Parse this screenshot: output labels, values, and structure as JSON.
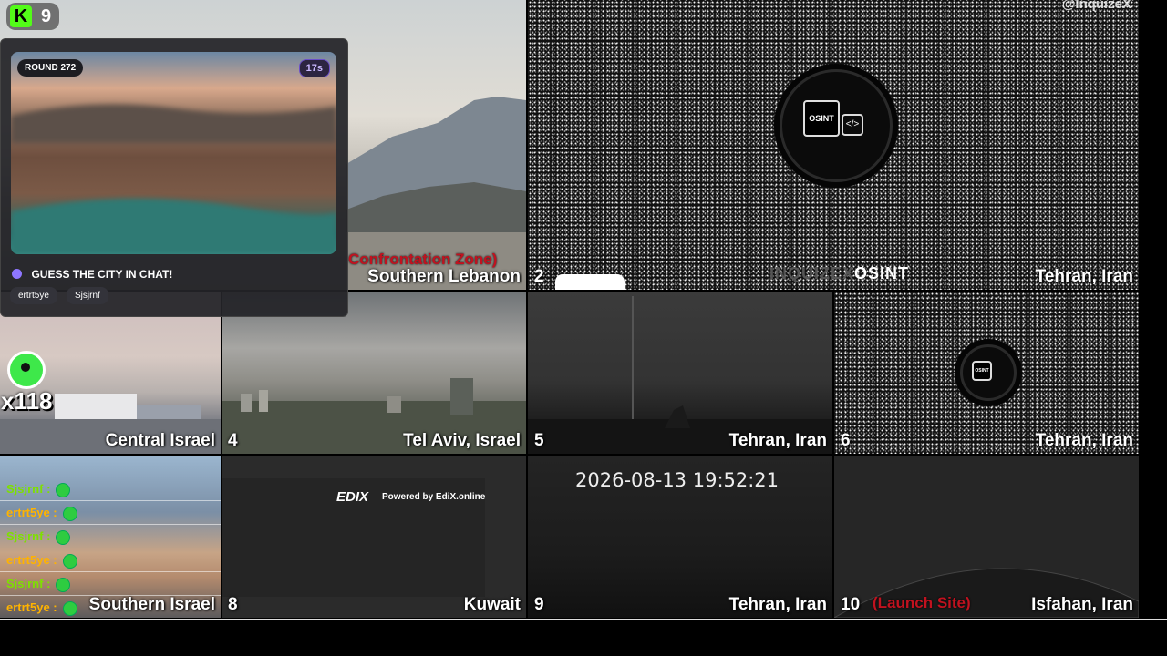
{
  "game": {
    "logo_letter": "K",
    "logo_count": "9",
    "round_label": "ROUND 272",
    "timer": "17s",
    "prompt": "GUESS THE CITY IN CHAT!",
    "players": [
      "ertrt5ye",
      "Sjsjrnf"
    ],
    "multiplier": "x118"
  },
  "watermark": "@InquizeX",
  "tiles": {
    "t1": {
      "number": "",
      "tag": "Confrontation Zone)",
      "location": "Southern Lebanon"
    },
    "t2": {
      "number": "2",
      "logo_text": "OSINT",
      "watermark_text": "INQUIZEX",
      "location": "Tehran, Iran"
    },
    "t3": {
      "number": "",
      "location": "Central Israel"
    },
    "t4": {
      "number": "4",
      "location": "Tel Aviv, Israel"
    },
    "t5": {
      "number": "5",
      "location": "Tehran, Iran"
    },
    "t6": {
      "number": "6",
      "logo_text": "OSINT",
      "location": "Tehran, Iran"
    },
    "t7": {
      "number": "",
      "location": "Southern Israel"
    },
    "t8": {
      "number": "8",
      "location": "Kuwait",
      "powered_by": "Powered by EdiX.online",
      "edix_logo": "EDIX"
    },
    "t9": {
      "number": "9",
      "timestamp": "2026-08-13 19:52:21",
      "location": "Tehran, Iran"
    },
    "t10": {
      "number": "10",
      "tag": "(Launch Site)",
      "location": "Isfahan, Iran"
    }
  },
  "chat": [
    {
      "user": "Sjsjrnf :",
      "color": "#7ee000"
    },
    {
      "user": "ertrt5ye :",
      "color": "#ffb300"
    },
    {
      "user": "Sjsjrnf :",
      "color": "#7ee000"
    },
    {
      "user": "ertrt5ye :",
      "color": "#ffb300"
    },
    {
      "user": "Sjsjrnf :",
      "color": "#7ee000"
    },
    {
      "user": "ertrt5ye :",
      "color": "#ffb300"
    }
  ]
}
